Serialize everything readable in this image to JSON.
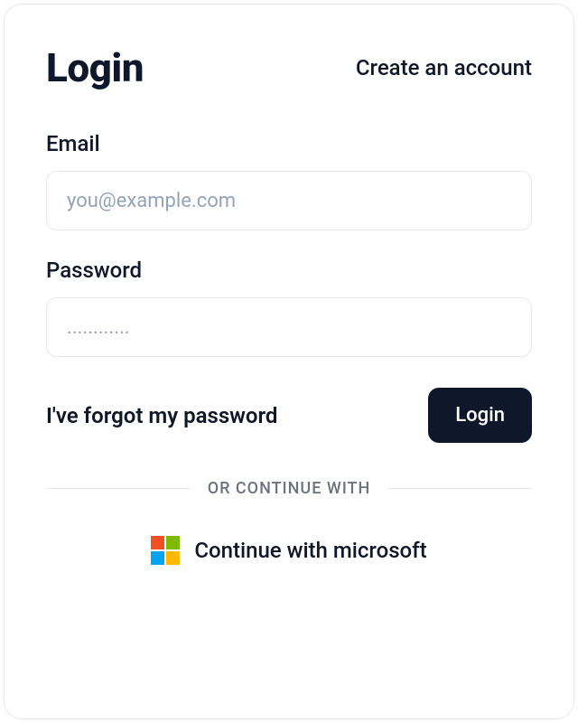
{
  "header": {
    "title": "Login",
    "create_account_label": "Create an account"
  },
  "form": {
    "email": {
      "label": "Email",
      "placeholder": "you@example.com",
      "value": ""
    },
    "password": {
      "label": "Password",
      "placeholder": "............",
      "value": ""
    }
  },
  "actions": {
    "forgot_password_label": "I've forgot my password",
    "login_button_label": "Login"
  },
  "divider": {
    "text": "OR CONTINUE WITH"
  },
  "sso": {
    "microsoft_label": "Continue with microsoft"
  }
}
